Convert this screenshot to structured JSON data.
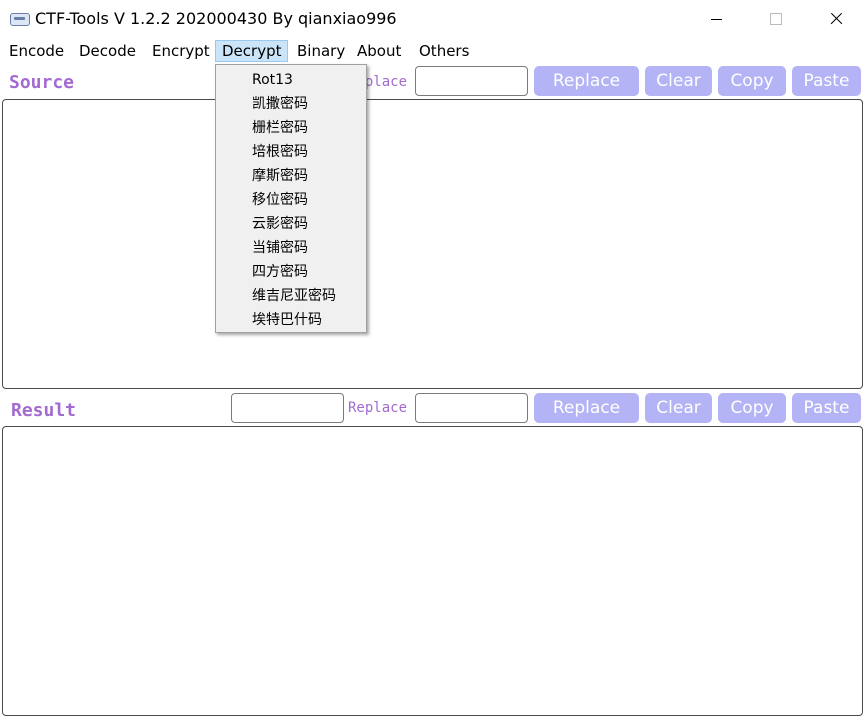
{
  "window": {
    "title": "CTF-Tools V 1.2.2 202000430 By qianxiao996"
  },
  "menu": {
    "items": [
      "Encode",
      "Decode",
      "Encrypt",
      "Decrypt",
      "Binary",
      "About",
      "Others"
    ],
    "active": "Decrypt"
  },
  "decrypt_menu": {
    "items": [
      "Rot13",
      "凯撒密码",
      "栅栏密码",
      "培根密码",
      "摩斯密码",
      "移位密码",
      "云影密码",
      "当铺密码",
      "四方密码",
      "维吉尼亚密码",
      "埃特巴什码"
    ]
  },
  "source": {
    "label": "Source",
    "replace_label": "Replace",
    "find_value": "",
    "replace_value": "",
    "text": "",
    "buttons": {
      "replace": "Replace",
      "clear": "Clear",
      "copy": "Copy",
      "paste": "Paste"
    }
  },
  "result": {
    "label": "Result",
    "replace_label": "Replace",
    "find_value": "",
    "replace_value": "",
    "text": "",
    "buttons": {
      "replace": "Replace",
      "clear": "Clear",
      "copy": "Copy",
      "paste": "Paste"
    }
  },
  "colors": {
    "label": "#a36ad1",
    "button_bg": "#b3b3f5",
    "menu_highlight": "#cce4f7"
  }
}
